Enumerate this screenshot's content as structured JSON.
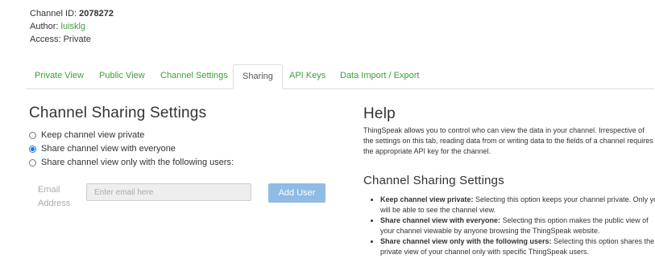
{
  "channel_info": {
    "id_label": "Channel ID: ",
    "id_value": "2078272",
    "author_label": "Author: ",
    "author_value": "luisklg",
    "access_label": "Access: ",
    "access_value": "Private"
  },
  "tabs": [
    {
      "label": "Private View"
    },
    {
      "label": "Public View"
    },
    {
      "label": "Channel Settings"
    },
    {
      "label": "Sharing"
    },
    {
      "label": "API Keys"
    },
    {
      "label": "Data Import / Export"
    }
  ],
  "active_tab": "Sharing",
  "sharing": {
    "title": "Channel Sharing Settings",
    "options": [
      {
        "label": "Keep channel view private",
        "checked": false
      },
      {
        "label": "Share channel view with everyone",
        "checked": true
      },
      {
        "label": "Share channel view only with the following users:",
        "checked": false
      }
    ],
    "email_label_1": "Email",
    "email_label_2": "Address",
    "email_placeholder": "Enter email here",
    "add_user_label": "Add User"
  },
  "help": {
    "title": "Help",
    "intro": "ThingSpeak allows you to control who can view the data in your channel. Irrespective of the settings on this tab, reading data from or writing data to the fields of a channel requires the appropriate API key for the channel.",
    "subtitle": "Channel Sharing Settings",
    "items": [
      {
        "term": "Keep channel view private:",
        "desc": " Selecting this option keeps your channel private. Only you will be able to see the channel view."
      },
      {
        "term": "Share channel view with everyone:",
        "desc": " Selecting this option makes the public view of your channel viewable by anyone browsing the ThingSpeak website."
      },
      {
        "term": "Share channel view only with the following users:",
        "desc": " Selecting this option shares the private view of your channel only with specific ThingSpeak users."
      }
    ]
  },
  "colors": {
    "link": "#3f9d3f",
    "radio_checked": "#1a73e8",
    "button": "#8fbbe4"
  }
}
